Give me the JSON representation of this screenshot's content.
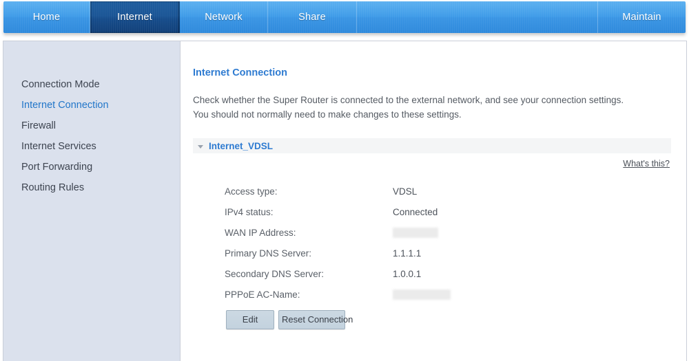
{
  "navbar": {
    "tabs": [
      {
        "label": "Home",
        "active": false
      },
      {
        "label": "Internet",
        "active": true
      },
      {
        "label": "Network",
        "active": false
      },
      {
        "label": "Share",
        "active": false
      },
      {
        "label": "Maintain",
        "active": false
      }
    ]
  },
  "sidebar": {
    "items": [
      {
        "label": "Connection Mode",
        "active": false
      },
      {
        "label": "Internet Connection",
        "active": true
      },
      {
        "label": "Firewall",
        "active": false
      },
      {
        "label": "Internet Services",
        "active": false
      },
      {
        "label": "Port Forwarding",
        "active": false
      },
      {
        "label": "Routing Rules",
        "active": false
      }
    ]
  },
  "main": {
    "title": "Internet Connection",
    "description_line1": "Check whether the Super Router is connected to the external network, and see your connection settings.",
    "description_line2": "You should not normally need to make changes to these settings.",
    "section": {
      "name": "Internet_VDSL",
      "expanded": true,
      "toggle_icon": "chevron-down-icon"
    },
    "help_link": "What's this?",
    "details": [
      {
        "label": "Access type:",
        "value": "VDSL",
        "redacted": false
      },
      {
        "label": "IPv4 status:",
        "value": "Connected",
        "redacted": false
      },
      {
        "label": "WAN IP Address:",
        "value": "",
        "redacted": true
      },
      {
        "label": "Primary DNS Server:",
        "value": "1.1.1.1",
        "redacted": false
      },
      {
        "label": "Secondary DNS Server:",
        "value": "1.0.0.1",
        "redacted": false
      },
      {
        "label": "PPPoE AC-Name:",
        "value": "",
        "redacted": true
      }
    ],
    "buttons": {
      "edit": "Edit",
      "reset": "Reset Connection"
    }
  },
  "colors": {
    "nav_blue": "#3f9ce8",
    "nav_active_blue": "#1a5596",
    "link_blue": "#2e7bd1",
    "sidebar_bg": "#dbe1ed",
    "button_bg": "#c6d4df"
  }
}
